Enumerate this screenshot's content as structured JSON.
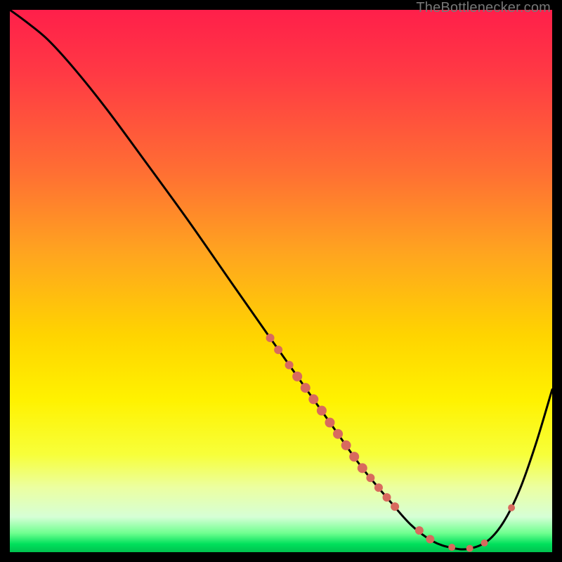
{
  "watermark": "TheBottlenecker.com",
  "chart_data": {
    "type": "line",
    "title": "",
    "xlabel": "",
    "ylabel": "",
    "xlim": [
      0,
      100
    ],
    "ylim": [
      0,
      100
    ],
    "gradient_stops": [
      {
        "offset": 0.0,
        "color": "#ff1f4a"
      },
      {
        "offset": 0.12,
        "color": "#ff3a44"
      },
      {
        "offset": 0.3,
        "color": "#ff6f33"
      },
      {
        "offset": 0.45,
        "color": "#ffa51f"
      },
      {
        "offset": 0.6,
        "color": "#ffd400"
      },
      {
        "offset": 0.72,
        "color": "#fff200"
      },
      {
        "offset": 0.82,
        "color": "#f7ff3a"
      },
      {
        "offset": 0.88,
        "color": "#ecffa0"
      },
      {
        "offset": 0.935,
        "color": "#d6ffd6"
      },
      {
        "offset": 0.965,
        "color": "#6fff8f"
      },
      {
        "offset": 0.985,
        "color": "#00e05c"
      },
      {
        "offset": 1.0,
        "color": "#00c24f"
      }
    ],
    "series": [
      {
        "name": "curve",
        "points": [
          {
            "x": 0.0,
            "y": 100.0
          },
          {
            "x": 3.0,
            "y": 97.8
          },
          {
            "x": 7.0,
            "y": 94.5
          },
          {
            "x": 12.0,
            "y": 89.0
          },
          {
            "x": 18.0,
            "y": 81.5
          },
          {
            "x": 25.0,
            "y": 72.0
          },
          {
            "x": 33.0,
            "y": 61.0
          },
          {
            "x": 41.0,
            "y": 49.5
          },
          {
            "x": 48.0,
            "y": 39.5
          },
          {
            "x": 54.0,
            "y": 31.0
          },
          {
            "x": 60.0,
            "y": 22.5
          },
          {
            "x": 65.0,
            "y": 15.5
          },
          {
            "x": 70.0,
            "y": 9.5
          },
          {
            "x": 74.0,
            "y": 5.0
          },
          {
            "x": 78.0,
            "y": 2.0
          },
          {
            "x": 81.5,
            "y": 0.8
          },
          {
            "x": 84.5,
            "y": 0.6
          },
          {
            "x": 88.0,
            "y": 2.0
          },
          {
            "x": 91.0,
            "y": 5.5
          },
          {
            "x": 94.0,
            "y": 11.5
          },
          {
            "x": 97.0,
            "y": 20.0
          },
          {
            "x": 100.0,
            "y": 30.0
          }
        ]
      }
    ],
    "markers": [
      {
        "x": 48.0,
        "y": 39.5,
        "r": 6
      },
      {
        "x": 49.5,
        "y": 37.3,
        "r": 6
      },
      {
        "x": 51.5,
        "y": 34.5,
        "r": 6
      },
      {
        "x": 53.0,
        "y": 32.4,
        "r": 7
      },
      {
        "x": 54.5,
        "y": 30.3,
        "r": 7
      },
      {
        "x": 56.0,
        "y": 28.2,
        "r": 7
      },
      {
        "x": 57.5,
        "y": 26.1,
        "r": 7
      },
      {
        "x": 59.0,
        "y": 23.9,
        "r": 7
      },
      {
        "x": 60.5,
        "y": 21.8,
        "r": 7
      },
      {
        "x": 62.0,
        "y": 19.7,
        "r": 7
      },
      {
        "x": 63.5,
        "y": 17.6,
        "r": 7
      },
      {
        "x": 65.0,
        "y": 15.5,
        "r": 7
      },
      {
        "x": 66.5,
        "y": 13.7,
        "r": 6
      },
      {
        "x": 68.0,
        "y": 11.9,
        "r": 6
      },
      {
        "x": 69.5,
        "y": 10.1,
        "r": 6
      },
      {
        "x": 71.0,
        "y": 8.4,
        "r": 6
      },
      {
        "x": 75.5,
        "y": 4.0,
        "r": 6
      },
      {
        "x": 77.5,
        "y": 2.4,
        "r": 6
      },
      {
        "x": 81.5,
        "y": 0.9,
        "r": 5
      },
      {
        "x": 84.8,
        "y": 0.7,
        "r": 5
      },
      {
        "x": 87.5,
        "y": 1.7,
        "r": 5
      },
      {
        "x": 92.5,
        "y": 8.2,
        "r": 5
      }
    ],
    "marker_color": "#d86a5e"
  }
}
